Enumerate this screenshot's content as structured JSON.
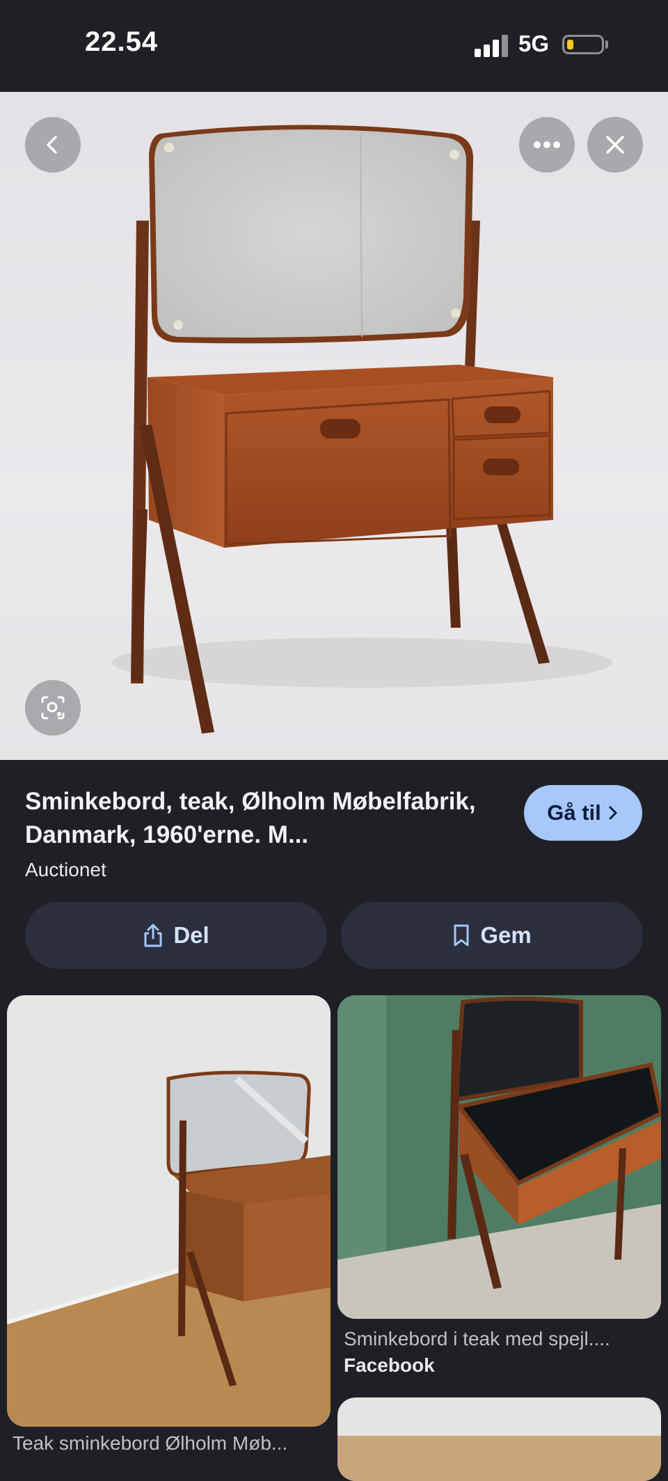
{
  "status_bar": {
    "time": "22.54",
    "network": "5G"
  },
  "result": {
    "title": "Sminkebord, teak, Ølholm Møbelfabrik, Danmark, 1960'erne. M...",
    "source": "Auctionet",
    "goto_label": "Gå til",
    "share_label": "Del",
    "save_label": "Gem"
  },
  "related": [
    {
      "caption": "Teak sminkebord Ølholm Møb..."
    },
    {
      "caption": "Sminkebord i teak med spejl....",
      "source": "Facebook"
    }
  ]
}
